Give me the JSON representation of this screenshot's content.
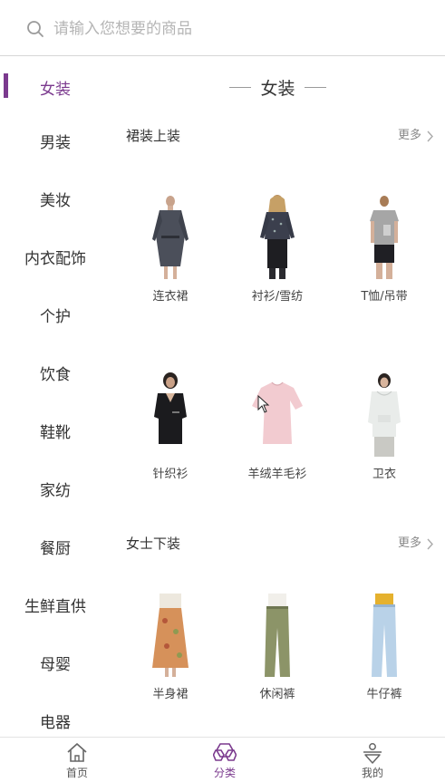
{
  "search": {
    "placeholder": "请输入您想要的商品",
    "icon": "search-icon"
  },
  "colors": {
    "accent": "#7b3a8e",
    "text": "#333333",
    "muted": "#888888"
  },
  "sidebar": {
    "items": [
      {
        "label": "女装",
        "active": true
      },
      {
        "label": "男装"
      },
      {
        "label": "美妆"
      },
      {
        "label": "内衣配饰"
      },
      {
        "label": "个护"
      },
      {
        "label": "饮食"
      },
      {
        "label": "鞋靴"
      },
      {
        "label": "家纺"
      },
      {
        "label": "餐厨"
      },
      {
        "label": "生鲜直供"
      },
      {
        "label": "母婴"
      },
      {
        "label": "电器"
      }
    ]
  },
  "content": {
    "title": "女装",
    "sections": [
      {
        "title": "裙装上装",
        "more": "更多",
        "products": [
          {
            "label": "连衣裙",
            "image": "dark-wrap-dress-photo"
          },
          {
            "label": "衬衫/雪纺",
            "image": "printed-blouse-photo"
          },
          {
            "label": "T恤/吊带",
            "image": "grey-tshirt-photo"
          },
          {
            "label": "针织衫",
            "image": "black-knit-top-photo"
          },
          {
            "label": "羊绒羊毛衫",
            "image": "pink-sweater-photo"
          },
          {
            "label": "卫衣",
            "image": "white-hoodie-photo"
          }
        ]
      },
      {
        "title": "女士下装",
        "more": "更多",
        "products": [
          {
            "label": "半身裙",
            "image": "floral-skirt-photo"
          },
          {
            "label": "休闲裤",
            "image": "olive-pants-photo"
          },
          {
            "label": "牛仔裤",
            "image": "light-jeans-photo"
          }
        ]
      }
    ]
  },
  "tabbar": {
    "tabs": [
      {
        "label": "首页",
        "icon": "home-icon"
      },
      {
        "label": "分类",
        "icon": "category-icon",
        "active": true
      },
      {
        "label": "我的",
        "icon": "profile-icon"
      }
    ]
  }
}
